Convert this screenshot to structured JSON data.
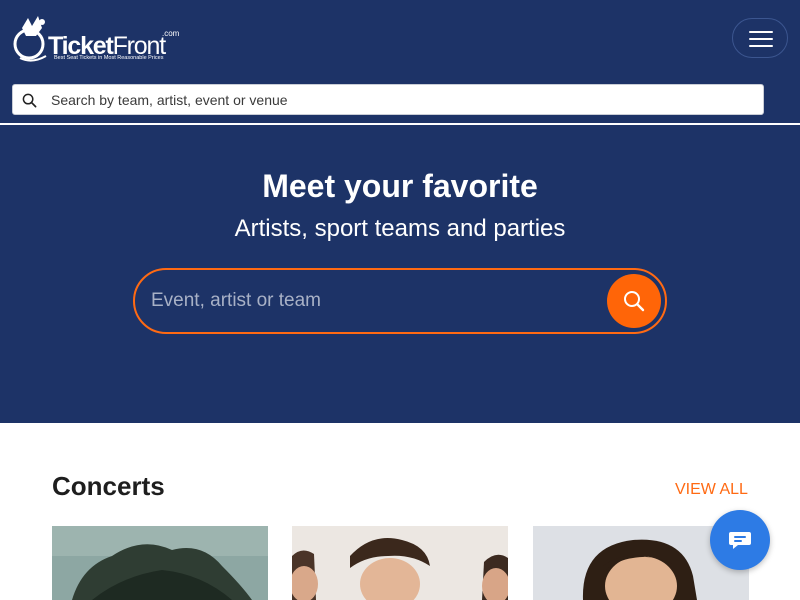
{
  "brand": {
    "name_bold": "Ticket",
    "name_regular": "Front",
    "suffix": ".com",
    "tagline": "Best Seat Tickets in Most Reasonable Prices"
  },
  "header": {
    "menu_icon": "hamburger-icon",
    "search": {
      "icon": "search-icon",
      "placeholder": "Search by team, artist, event or venue",
      "value": ""
    }
  },
  "hero": {
    "title": "Meet your favorite",
    "subtitle": "Artists, sport teams and parties",
    "search": {
      "placeholder": "Event, artist or team",
      "value": "",
      "button_icon": "search-icon"
    }
  },
  "concerts": {
    "title": "Concerts",
    "view_all": "VIEW ALL",
    "cards": [
      {
        "image": "concert-image-1"
      },
      {
        "image": "concert-image-2"
      },
      {
        "image": "concert-image-3"
      }
    ]
  },
  "chat": {
    "icon": "chat-bubble-icon"
  },
  "colors": {
    "navy": "#1d3367",
    "accent_orange": "#ff6508",
    "chat_blue": "#2d7be5"
  }
}
